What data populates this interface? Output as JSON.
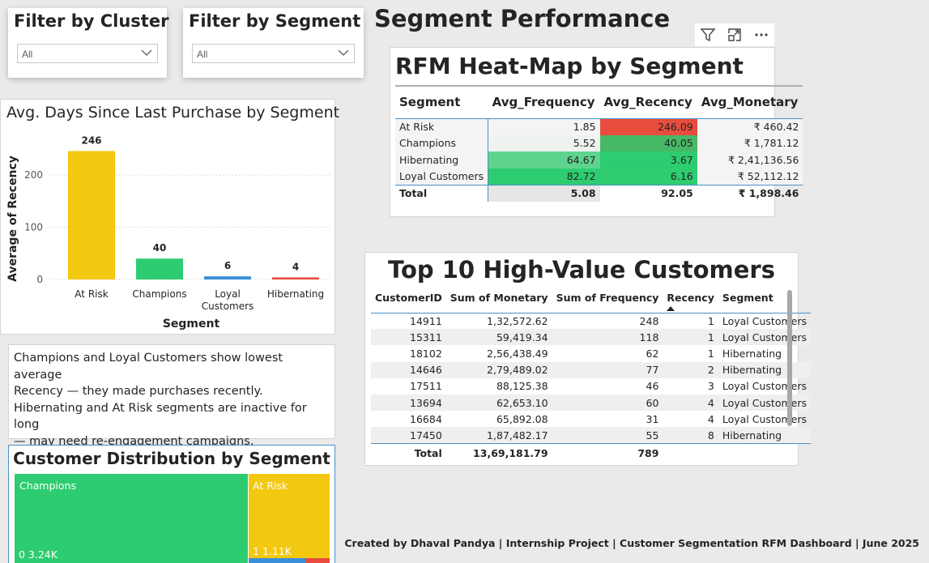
{
  "page_title": "Segment Performance",
  "footer": "Created by Dhaval Pandya | Internship Project | Customer Segmentation RFM Dashboard | June 2025",
  "slicers": [
    {
      "title": "Filter by Cluster",
      "value": "All"
    },
    {
      "title": "Filter by Segment",
      "value": "All"
    }
  ],
  "visual_icons": [
    "filter-icon",
    "focus-mode-icon",
    "more-options-icon"
  ],
  "bar_chart": {
    "title": "Avg. Days Since Last Purchase by Segment",
    "color_yellow": "#f2c811",
    "color_green": "#2ecc71",
    "color_blue": "#3a8fd9",
    "color_red": "#e74c3c"
  },
  "chart_data": {
    "type": "bar",
    "title": "Avg. Days Since Last Purchase by Segment",
    "categories": [
      "At Risk",
      "Champions",
      "Loyal Customers",
      "Hibernating"
    ],
    "category_labels": [
      [
        "At Risk"
      ],
      [
        "Champions"
      ],
      [
        "Loyal",
        "Customers"
      ],
      [
        "Hibernating"
      ]
    ],
    "values": [
      246,
      40,
      6,
      4
    ],
    "data_labels": [
      "246",
      "40",
      "6",
      "4"
    ],
    "colors": [
      "#f2c811",
      "#2ecc71",
      "#3a8fd9",
      "#e74c3c"
    ],
    "xlabel": "Segment",
    "ylabel": "Average of Recency",
    "yticks": [
      0,
      100,
      200
    ],
    "ytick_labels": [
      "0",
      "100",
      "200"
    ],
    "ylim": [
      0,
      270
    ],
    "grid": true
  },
  "heatmap": {
    "title": "RFM Heat-Map by Segment",
    "columns": [
      "Segment",
      "Avg_Frequency",
      "Avg_Recency",
      "Avg_Monetary"
    ],
    "rows": [
      {
        "segment": "At Risk",
        "freq": "1.85",
        "rec": "246.09",
        "mon": "₹ 460.42",
        "freq_bg": "#f4f4f4",
        "rec_bg": "#e74c3c"
      },
      {
        "segment": "Champions",
        "freq": "5.52",
        "rec": "40.05",
        "mon": "₹ 1,781.12",
        "freq_bg": "#eef3ef",
        "rec_bg": "#47b866"
      },
      {
        "segment": "Hibernating",
        "freq": "64.67",
        "rec": "3.67",
        "mon": "₹ 2,41,136.56",
        "freq_bg": "#5fd48e",
        "rec_bg": "#2ecc71"
      },
      {
        "segment": "Loyal Customers",
        "freq": "82.72",
        "rec": "6.16",
        "mon": "₹ 52,112.12",
        "freq_bg": "#2ecc71",
        "rec_bg": "#2fcc70"
      }
    ],
    "total": {
      "label": "Total",
      "freq": "5.08",
      "rec": "92.05",
      "mon": "₹ 1,898.46"
    }
  },
  "top10": {
    "title": "Top 10 High-Value Customers",
    "columns": [
      "CustomerID",
      "Sum of Monetary",
      "Sum of Frequency",
      "Recency",
      "Segment"
    ],
    "rows": [
      [
        "14911",
        "1,32,572.62",
        "248",
        "1",
        "Loyal Customers"
      ],
      [
        "15311",
        "59,419.34",
        "118",
        "1",
        "Loyal Customers"
      ],
      [
        "18102",
        "2,56,438.49",
        "62",
        "1",
        "Hibernating"
      ],
      [
        "14646",
        "2,79,489.02",
        "77",
        "2",
        "Hibernating"
      ],
      [
        "17511",
        "88,125.38",
        "46",
        "3",
        "Loyal Customers"
      ],
      [
        "13694",
        "62,653.10",
        "60",
        "4",
        "Loyal Customers"
      ],
      [
        "16684",
        "65,892.08",
        "31",
        "4",
        "Loyal Customers"
      ],
      [
        "17450",
        "1,87,482.17",
        "55",
        "8",
        "Hibernating"
      ]
    ],
    "total": [
      "Total",
      "13,69,181.79",
      "789",
      "",
      ""
    ]
  },
  "note": {
    "lines": [
      "Champions and Loyal Customers show lowest average",
      "Recency — they made purchases recently.",
      "Hibernating and At Risk segments are inactive for long",
      "— may need re-engagement campaigns."
    ]
  },
  "treemap": {
    "title": "Customer Distribution by Segment",
    "tiles": [
      {
        "name": "Champions",
        "value_label": "0 3.24K",
        "color": "#2ecc71"
      },
      {
        "name": "At Risk",
        "value_label": "1 1.11K",
        "color": "#f2c811"
      }
    ]
  }
}
